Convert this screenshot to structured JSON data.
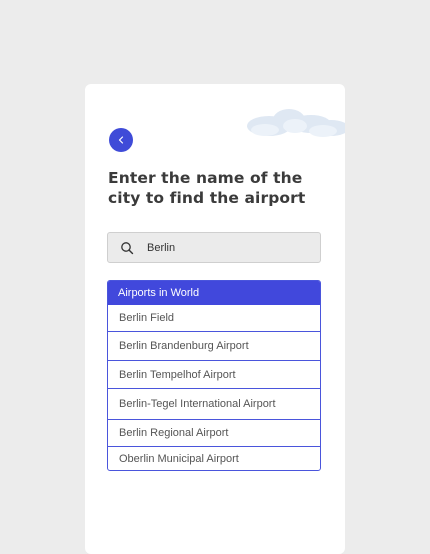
{
  "header": {
    "title": "Enter the name of the city to find the airport",
    "back_icon": "chevron-left-icon"
  },
  "search": {
    "value": "Berlin",
    "icon": "search-icon"
  },
  "results": {
    "header": "Airports in World",
    "items": [
      "Berlin Field",
      "Berlin Brandenburg Airport",
      "Berlin Tempelhof Airport",
      "Berlin-Tegel International Airport",
      "Berlin Regional Airport",
      "Oberlin Municipal Airport"
    ]
  },
  "colors": {
    "accent": "#4148dc",
    "background": "#ececec",
    "card": "#ffffff"
  }
}
